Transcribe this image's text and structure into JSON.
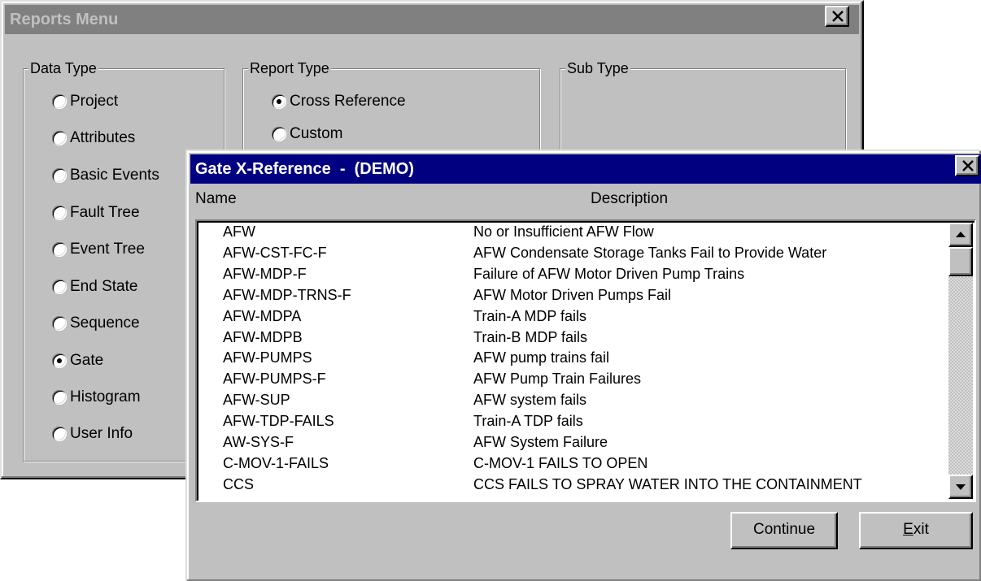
{
  "reports_menu": {
    "title": "Reports Menu",
    "data_type": {
      "legend": "Data Type",
      "options": [
        {
          "label": "Project",
          "checked": false
        },
        {
          "label": "Attributes",
          "checked": false
        },
        {
          "label": "Basic Events",
          "checked": false
        },
        {
          "label": "Fault Tree",
          "checked": false
        },
        {
          "label": "Event Tree",
          "checked": false
        },
        {
          "label": "End State",
          "checked": false
        },
        {
          "label": "Sequence",
          "checked": false
        },
        {
          "label": "Gate",
          "checked": true
        },
        {
          "label": "Histogram",
          "checked": false
        },
        {
          "label": "User Info",
          "checked": false
        }
      ]
    },
    "report_type": {
      "legend": "Report Type",
      "options": [
        {
          "label": "Cross Reference",
          "checked": true
        },
        {
          "label": "Custom",
          "checked": false
        }
      ]
    },
    "sub_type": {
      "legend": "Sub Type"
    }
  },
  "gate_xref": {
    "title": "Gate X-Reference  -  (DEMO)",
    "col_name": "Name",
    "col_description": "Description",
    "rows": [
      {
        "name": "AFW",
        "description": "No or Insufficient AFW Flow"
      },
      {
        "name": "AFW-CST-FC-F",
        "description": "AFW Condensate Storage Tanks Fail to Provide Water"
      },
      {
        "name": "AFW-MDP-F",
        "description": "Failure of AFW Motor Driven Pump Trains"
      },
      {
        "name": "AFW-MDP-TRNS-F",
        "description": "AFW Motor Driven Pumps Fail"
      },
      {
        "name": "AFW-MDPA",
        "description": "Train-A MDP fails"
      },
      {
        "name": "AFW-MDPB",
        "description": "Train-B MDP fails"
      },
      {
        "name": "AFW-PUMPS",
        "description": "AFW pump trains fail"
      },
      {
        "name": "AFW-PUMPS-F",
        "description": "AFW Pump Train Failures"
      },
      {
        "name": "AFW-SUP",
        "description": "AFW system fails"
      },
      {
        "name": "AFW-TDP-FAILS",
        "description": "Train-A TDP fails"
      },
      {
        "name": "AW-SYS-F",
        "description": "AFW System Failure"
      },
      {
        "name": "C-MOV-1-FAILS",
        "description": "C-MOV-1 FAILS TO OPEN"
      },
      {
        "name": "CCS",
        "description": "CCS FAILS TO SPRAY WATER INTO THE CONTAINMENT"
      }
    ],
    "continue_label": "Continue",
    "exit_label_ul": "E",
    "exit_label_rest": "xit"
  },
  "colors": {
    "active_title": "#000080",
    "inactive_title": "#808080",
    "face": "#c0c0c0"
  }
}
